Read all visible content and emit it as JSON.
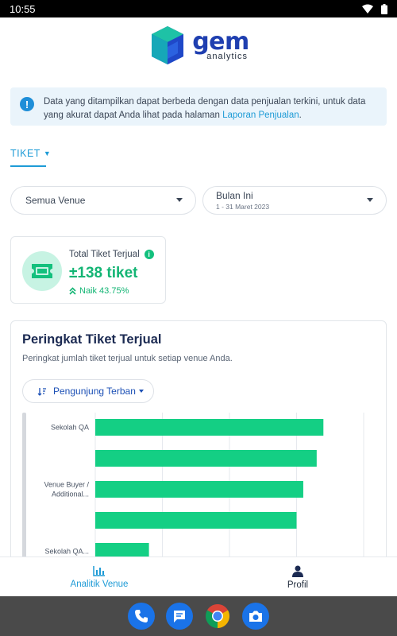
{
  "status_bar": {
    "time": "10:55"
  },
  "header": {
    "logo_word": "gem",
    "logo_sub": "analytics"
  },
  "info_banner": {
    "text": "Data yang ditampilkan dapat berbeda dengan data penjualan terkini, untuk data yang akurat dapat Anda lihat pada halaman ",
    "link": "Laporan Penjualan",
    "suffix": "."
  },
  "tab": {
    "label": "TIKET"
  },
  "filters": {
    "venue": "Semua Venue",
    "period": "Bulan Ini",
    "period_range": "1 - 31 Maret 2023"
  },
  "stat_card": {
    "label": "Total Tiket Terjual",
    "value": "±138 tiket",
    "change": "Naik 43.75%"
  },
  "ranking": {
    "title": "Peringkat Tiket Terjual",
    "subtitle": "Peringkat jumlah tiket terjual untuk setiap venue Anda.",
    "sort_label": "Pengunjung Terban"
  },
  "chart_data": {
    "type": "bar",
    "orientation": "horizontal",
    "categories": [
      "Sekolah QA",
      "",
      "Venue Buyer / Additional...",
      "",
      "Sekolah QA..."
    ],
    "values": [
      68,
      66,
      62,
      60,
      16
    ],
    "xlim": [
      0,
      80
    ],
    "grid": true,
    "color": "#14cf84"
  },
  "bottom_nav": {
    "items": [
      {
        "label": "Analitik Venue",
        "active": true
      },
      {
        "label": "Profil",
        "active": false
      }
    ]
  },
  "colors": {
    "accent": "#1e9bd6",
    "green": "#13b574",
    "brand_blue": "#1f3fb0"
  }
}
